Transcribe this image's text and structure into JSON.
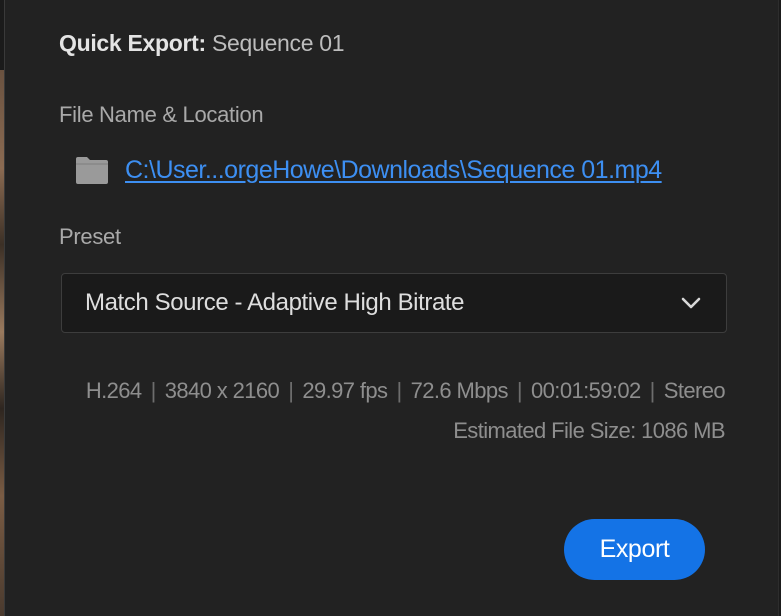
{
  "dialog": {
    "title_label": "Quick Export:",
    "title_value": "Sequence 01"
  },
  "file": {
    "section_label": "File Name & Location",
    "icon": "folder-icon",
    "path": "C:\\User...orgeHowe\\Downloads\\Sequence 01.mp4"
  },
  "preset": {
    "section_label": "Preset",
    "selected": "Match Source - Adaptive High Bitrate",
    "icon": "chevron-down-icon"
  },
  "specs": {
    "codec": "H.264",
    "resolution": "3840 x 2160",
    "frame_rate": "29.97 fps",
    "bitrate": "72.6 Mbps",
    "duration": "00:01:59:02",
    "audio": "Stereo",
    "separator": "|",
    "estimated_size": "Estimated File Size: 1086 MB"
  },
  "actions": {
    "export_label": "Export"
  },
  "colors": {
    "panel_bg": "#222222",
    "link": "#3d8ff2",
    "accent": "#1473e6"
  }
}
